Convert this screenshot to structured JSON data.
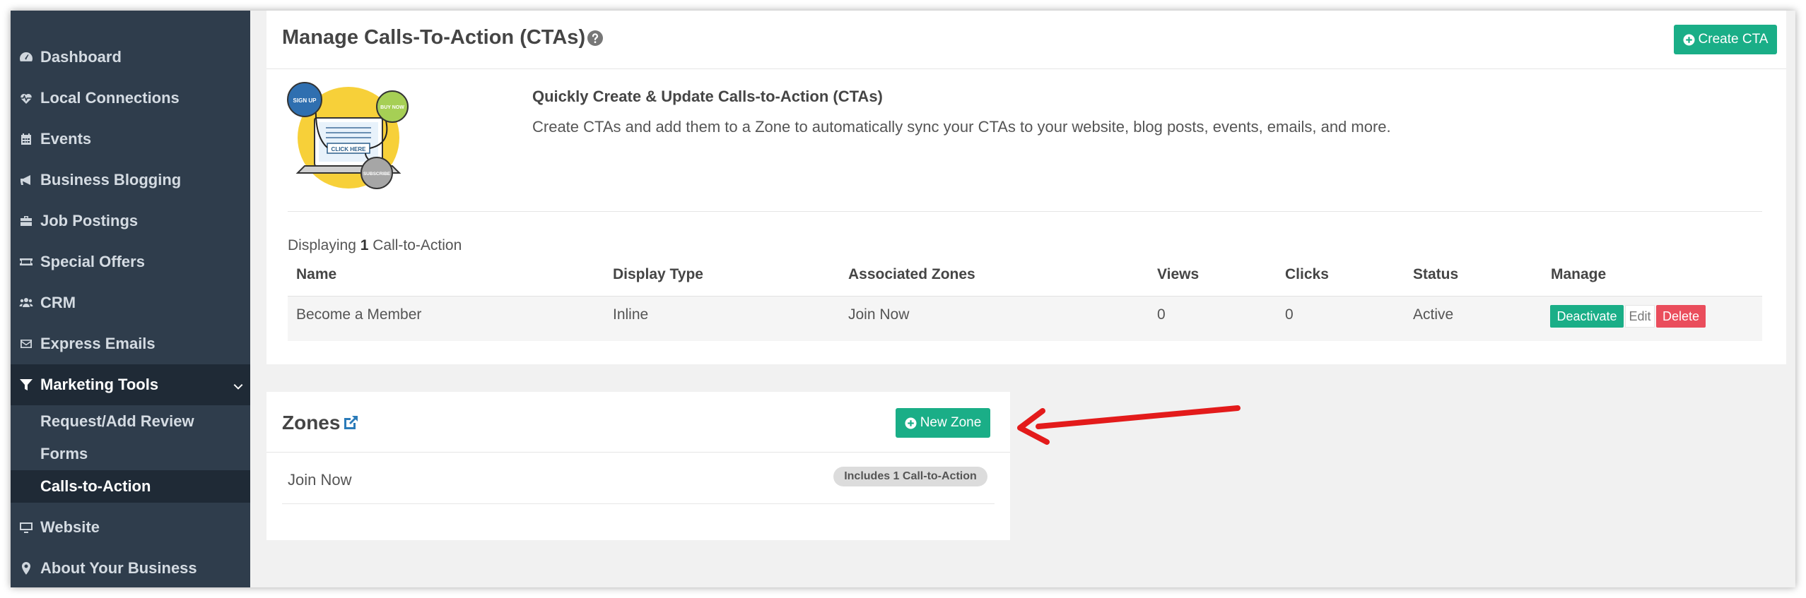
{
  "sidebar": {
    "items": [
      {
        "label": "Dashboard",
        "icon": "dashboard-icon"
      },
      {
        "label": "Local Connections",
        "icon": "heartbeat-icon"
      },
      {
        "label": "Events",
        "icon": "calendar-icon"
      },
      {
        "label": "Business Blogging",
        "icon": "bullhorn-icon"
      },
      {
        "label": "Job Postings",
        "icon": "briefcase-icon"
      },
      {
        "label": "Special Offers",
        "icon": "ticket-icon"
      },
      {
        "label": "CRM",
        "icon": "users-icon"
      },
      {
        "label": "Express Emails",
        "icon": "envelope-icon"
      },
      {
        "label": "Marketing Tools",
        "icon": "filter-icon"
      },
      {
        "label": "Website",
        "icon": "monitor-icon"
      },
      {
        "label": "About Your Business",
        "icon": "map-marker-icon"
      }
    ],
    "subitems": [
      {
        "label": "Request/Add Review"
      },
      {
        "label": "Forms"
      },
      {
        "label": "Calls-to-Action"
      }
    ]
  },
  "cta_panel": {
    "title": "Manage Calls-To-Action (CTAs)",
    "create_button": "Create CTA",
    "illustration_labels": {
      "sign_up": "SIGN UP",
      "buy_now": "BUY NOW",
      "click_here": "CLICK HERE",
      "subscribe": "SUBSCRIBE"
    },
    "intro_heading": "Quickly Create & Update Calls-to-Action (CTAs)",
    "intro_text": "Create CTAs and add them to a Zone to automatically sync your CTAs to your website, blog posts, events, emails, and more.",
    "display_prefix": "Displaying ",
    "display_count": "1",
    "display_suffix": " Call-to-Action",
    "columns": {
      "name": "Name",
      "display_type": "Display Type",
      "associated_zones": "Associated Zones",
      "views": "Views",
      "clicks": "Clicks",
      "status": "Status",
      "manage": "Manage"
    },
    "rows": [
      {
        "name": "Become a Member",
        "display_type": "Inline",
        "zones": "Join Now",
        "views": "0",
        "clicks": "0",
        "status": "Active",
        "deactivate": "Deactivate",
        "edit": "Edit",
        "delete": "Delete"
      }
    ]
  },
  "zones_panel": {
    "title": "Zones",
    "new_button": "New Zone",
    "zones": [
      {
        "name": "Join Now",
        "badge": "Includes 1 Call-to-Action"
      }
    ]
  },
  "colors": {
    "sidebar_bg": "#2f3d4c",
    "sidebar_active": "#1f2a36",
    "accent_green": "#1aae87",
    "delete_red": "#ea4d5c",
    "link_blue": "#2b7bb9",
    "annotation_red": "#e31b1b"
  }
}
